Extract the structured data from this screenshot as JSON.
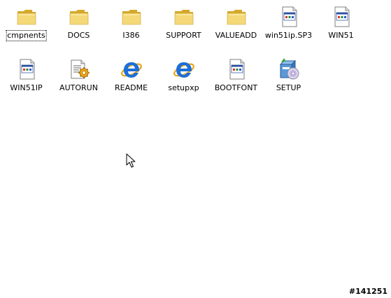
{
  "items": [
    {
      "label": "cmpnents",
      "icon": "folder-icon",
      "type": "folder",
      "focused": true
    },
    {
      "label": "DOCS",
      "icon": "folder-icon",
      "type": "folder"
    },
    {
      "label": "I386",
      "icon": "folder-icon",
      "type": "folder"
    },
    {
      "label": "SUPPORT",
      "icon": "folder-icon",
      "type": "folder"
    },
    {
      "label": "VALUEADD",
      "icon": "folder-icon",
      "type": "folder"
    },
    {
      "label": "win51ip.SP3",
      "icon": "system-file-icon",
      "type": "file"
    },
    {
      "label": "WIN51",
      "icon": "system-file-icon",
      "type": "file"
    },
    {
      "label": "WIN51IP",
      "icon": "system-file-icon",
      "type": "file"
    },
    {
      "label": "AUTORUN",
      "icon": "autorun-icon",
      "type": "file"
    },
    {
      "label": "README",
      "icon": "internet-explorer-icon",
      "type": "file"
    },
    {
      "label": "setupxp",
      "icon": "internet-explorer-icon",
      "type": "file"
    },
    {
      "label": "BOOTFONT",
      "icon": "system-file-icon",
      "type": "file"
    },
    {
      "label": "SETUP",
      "icon": "setup-icon",
      "type": "file"
    }
  ],
  "watermark": "#141251",
  "colors": {
    "folder": "#f5d978",
    "folder_dark": "#d4a92a",
    "ie_blue": "#1c6fd8",
    "ie_gold": "#e8a620"
  }
}
